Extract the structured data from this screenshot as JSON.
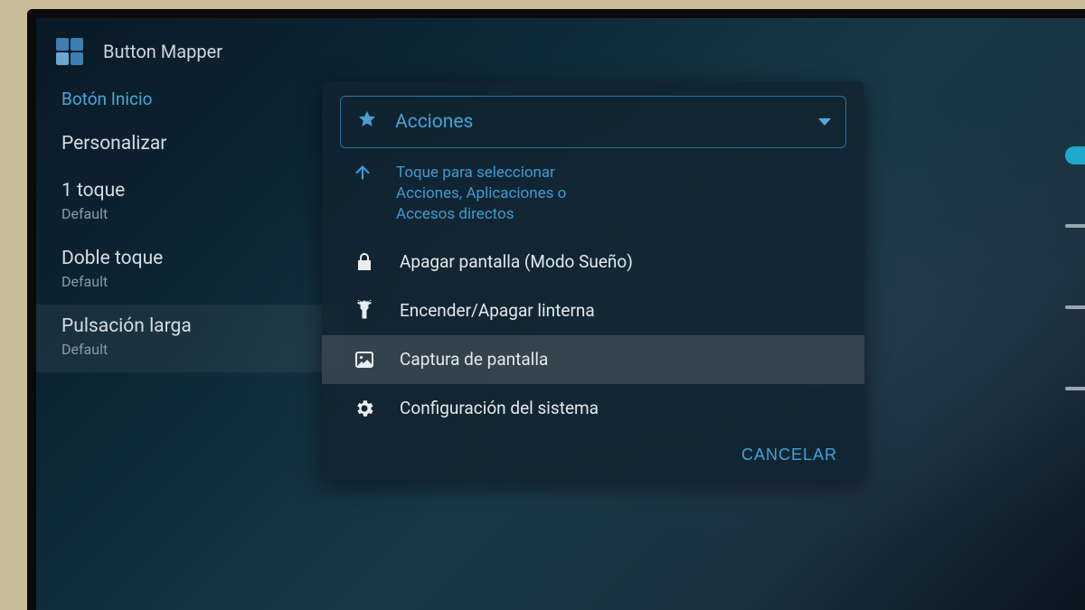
{
  "app": {
    "title": "Button Mapper"
  },
  "sidebar": {
    "home_link": "Botón Inicio",
    "customize": "Personalizar",
    "items": [
      {
        "title": "1 toque",
        "sub": "Default"
      },
      {
        "title": "Doble toque",
        "sub": "Default"
      },
      {
        "title": "Pulsación larga",
        "sub": "Default"
      }
    ]
  },
  "dialog": {
    "dropdown_label": "Acciones",
    "hint": "Toque para seleccionar Acciones, Aplicaciones o Accesos directos",
    "actions": [
      {
        "icon": "lock",
        "label": "Apagar pantalla (Modo Sueño)",
        "selected": false
      },
      {
        "icon": "flashlight",
        "label": "Encender/Apagar linterna",
        "selected": false
      },
      {
        "icon": "image",
        "label": "Captura de pantalla",
        "selected": true
      },
      {
        "icon": "gear",
        "label": "Configuración del sistema",
        "selected": false
      }
    ],
    "cancel": "CANCELAR"
  }
}
